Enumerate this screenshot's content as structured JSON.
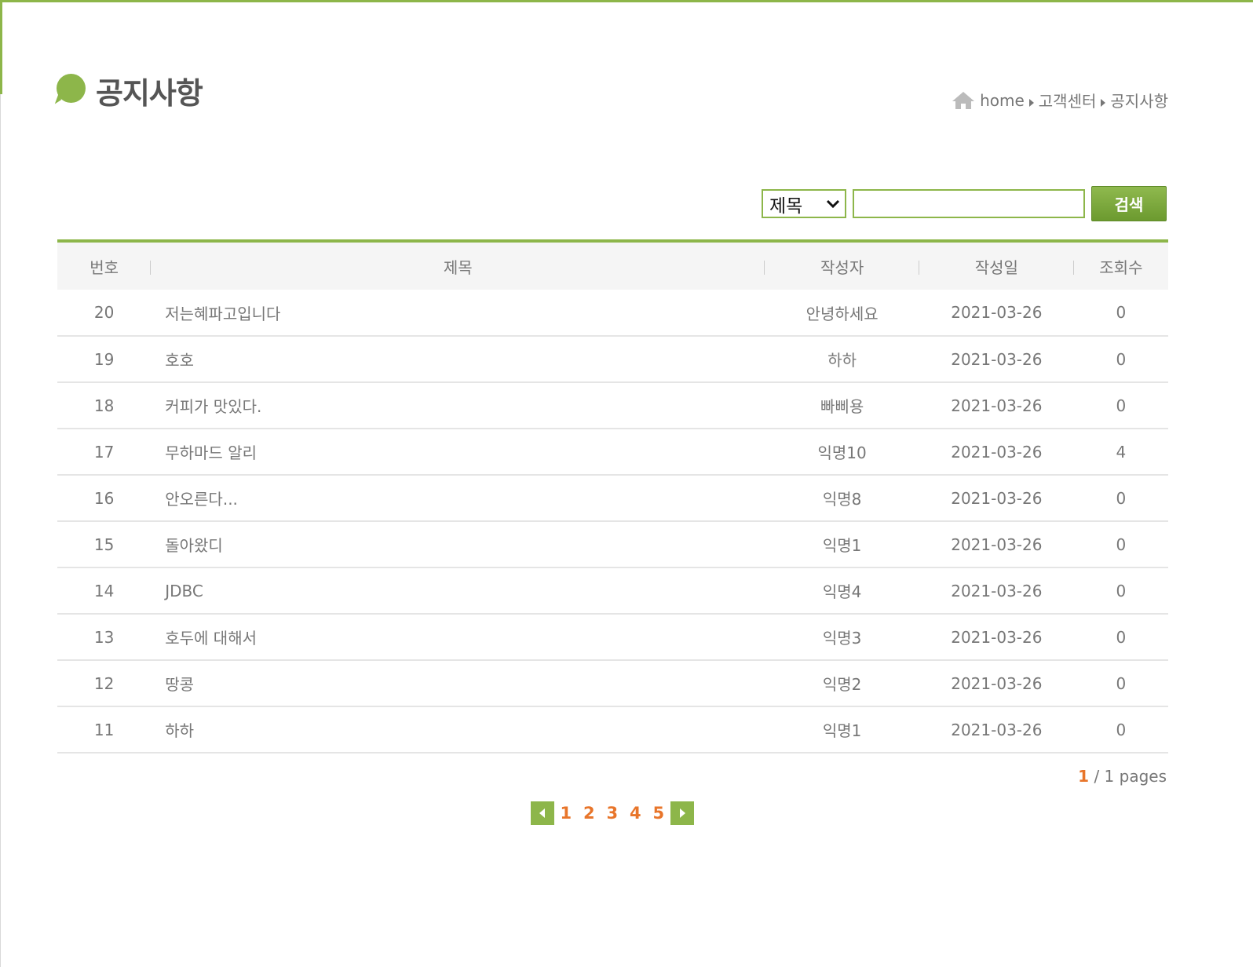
{
  "page": {
    "title": "공지사항"
  },
  "breadcrumb": {
    "home": "home",
    "section": "고객센터",
    "current": "공지사항"
  },
  "search": {
    "selected_option": "제목",
    "input_value": "",
    "button_label": "검색"
  },
  "table": {
    "headers": [
      "번호",
      "제목",
      "작성자",
      "작성일",
      "조회수"
    ],
    "rows": [
      {
        "no": "20",
        "title": "저는혜파고입니다",
        "author": "안녕하세요",
        "date": "2021-03-26",
        "views": "0"
      },
      {
        "no": "19",
        "title": "호호",
        "author": "하하",
        "date": "2021-03-26",
        "views": "0"
      },
      {
        "no": "18",
        "title": "커피가 맛있다.",
        "author": "빠삐용",
        "date": "2021-03-26",
        "views": "0"
      },
      {
        "no": "17",
        "title": "무하마드 알리",
        "author": "익명10",
        "date": "2021-03-26",
        "views": "4"
      },
      {
        "no": "16",
        "title": "안오른다...",
        "author": "익명8",
        "date": "2021-03-26",
        "views": "0"
      },
      {
        "no": "15",
        "title": "돌아왔디",
        "author": "익명1",
        "date": "2021-03-26",
        "views": "0"
      },
      {
        "no": "14",
        "title": "JDBC",
        "author": "익명4",
        "date": "2021-03-26",
        "views": "0"
      },
      {
        "no": "13",
        "title": "호두에 대해서",
        "author": "익명3",
        "date": "2021-03-26",
        "views": "0"
      },
      {
        "no": "12",
        "title": "땅콩",
        "author": "익명2",
        "date": "2021-03-26",
        "views": "0"
      },
      {
        "no": "11",
        "title": "하하",
        "author": "익명1",
        "date": "2021-03-26",
        "views": "0"
      }
    ]
  },
  "pages_info": {
    "current": "1",
    "rest": " / 1 pages"
  },
  "pagination": {
    "pages": [
      "1",
      "2",
      "3",
      "4",
      "5"
    ]
  },
  "colors": {
    "accent": "#8db64a",
    "page_number": "#e8752a"
  }
}
